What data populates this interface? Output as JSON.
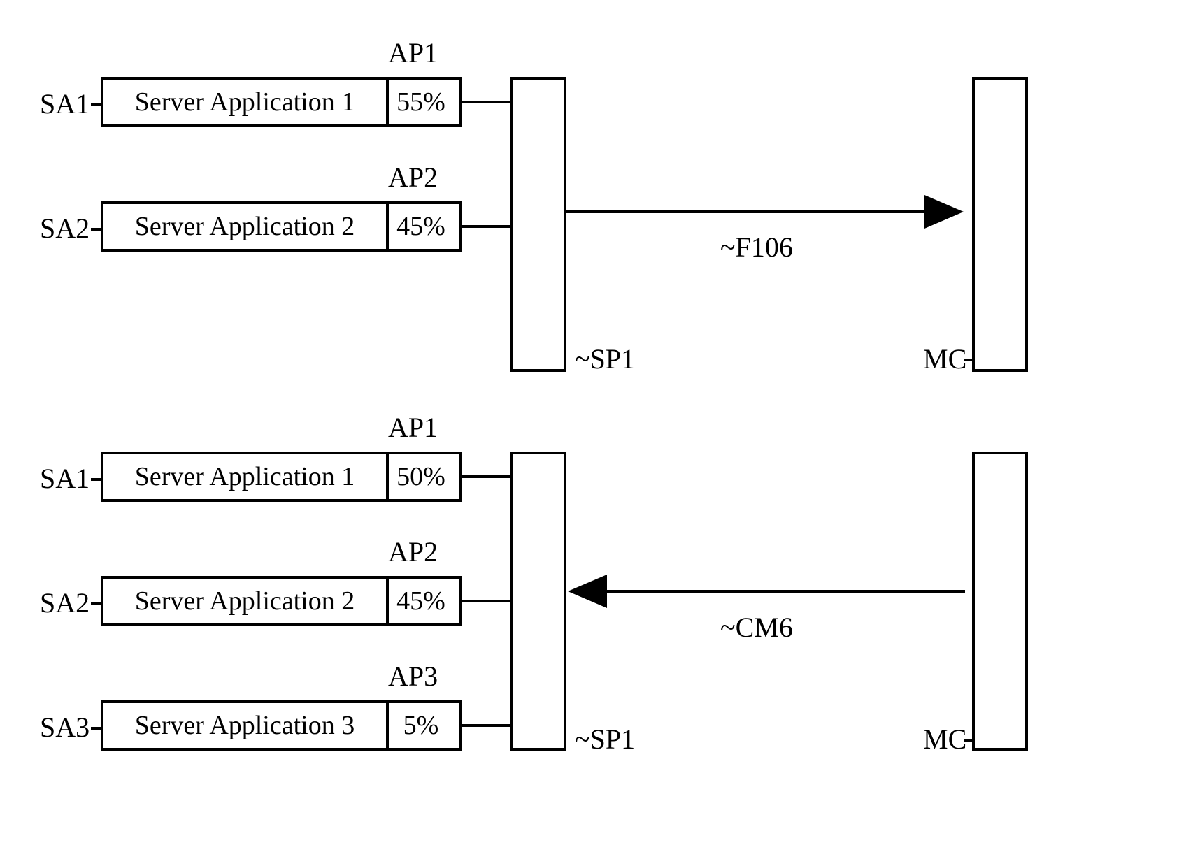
{
  "chart_data": {
    "type": "diagram",
    "title": "",
    "groups": [
      {
        "rows": [
          {
            "sa": "SA1",
            "ap": "AP1",
            "name": "Server Application 1",
            "percent": "55%"
          },
          {
            "sa": "SA2",
            "ap": "AP2",
            "name": "Server Application 2",
            "percent": "45%"
          }
        ],
        "sp": "~SP1",
        "flow": "~F106",
        "mc": "MC",
        "arrow_dir": "right"
      },
      {
        "rows": [
          {
            "sa": "SA1",
            "ap": "AP1",
            "name": "Server Application 1",
            "percent": "50%"
          },
          {
            "sa": "SA2",
            "ap": "AP2",
            "name": "Server Application 2",
            "percent": "45%"
          },
          {
            "sa": "SA3",
            "ap": "AP3",
            "name": "Server Application 3",
            "percent": "5%"
          }
        ],
        "sp": "~SP1",
        "flow": "~CM6",
        "mc": "MC",
        "arrow_dir": "left"
      }
    ]
  },
  "g1": {
    "ap1": "AP1",
    "ap2": "AP2",
    "sa1": "SA1",
    "sa2": "SA2",
    "name1": "Server Application 1",
    "pct1": "55%",
    "name2": "Server Application 2",
    "pct2": "45%",
    "sp": "~SP1",
    "flow": "~F106",
    "mc": "MC"
  },
  "g2": {
    "ap1": "AP1",
    "ap2": "AP2",
    "ap3": "AP3",
    "sa1": "SA1",
    "sa2": "SA2",
    "sa3": "SA3",
    "name1": "Server Application 1",
    "pct1": "50%",
    "name2": "Server Application 2",
    "pct2": "45%",
    "name3": "Server Application 3",
    "pct3": "5%",
    "sp": "~SP1",
    "flow": "~CM6",
    "mc": "MC"
  }
}
